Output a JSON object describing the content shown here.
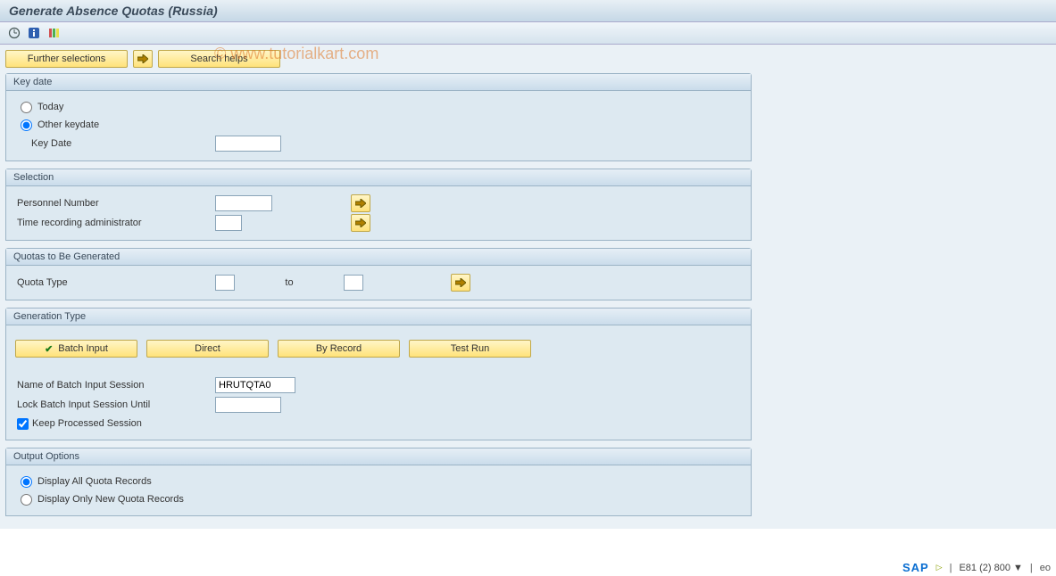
{
  "title": "Generate Absence Quotas (Russia)",
  "watermark": "© www.tutorialkart.com",
  "top_buttons": {
    "further_selections": "Further selections",
    "search_helps": "Search helps"
  },
  "key_date": {
    "legend": "Key date",
    "today": "Today",
    "other_keydate": "Other keydate",
    "key_date_label": "Key Date",
    "key_date_value": ""
  },
  "selection": {
    "legend": "Selection",
    "personnel_number": "Personnel Number",
    "personnel_number_value": "",
    "time_admin": "Time recording administrator",
    "time_admin_value": ""
  },
  "quotas": {
    "legend": "Quotas to Be Generated",
    "quota_type": "Quota Type",
    "to": "to",
    "from_value": "",
    "to_value": ""
  },
  "generation": {
    "legend": "Generation Type",
    "batch_input": "Batch Input",
    "direct": "Direct",
    "by_record": "By Record",
    "test_run": "Test Run",
    "name_session": "Name of Batch Input Session",
    "name_session_value": "HRUTQTA0",
    "lock_until": "Lock Batch Input Session Until",
    "lock_until_value": "",
    "keep_processed": "Keep Processed Session"
  },
  "output": {
    "legend": "Output Options",
    "display_all": "Display All Quota Records",
    "display_new": "Display Only New Quota Records"
  },
  "status": {
    "system": "E81 (2) 800",
    "suffix": "eo"
  }
}
